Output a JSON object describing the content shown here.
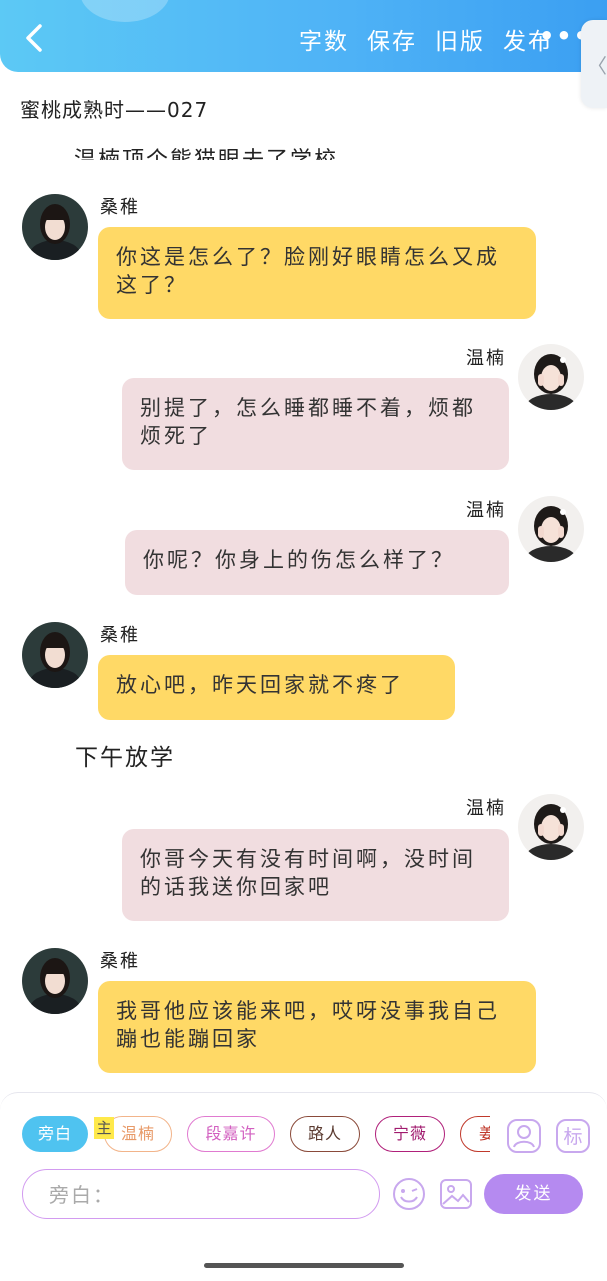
{
  "header": {
    "actions": [
      "字数",
      "保存",
      "旧版",
      "发布"
    ],
    "more_label": "•••",
    "side_tab_glyph": "〈"
  },
  "doc": {
    "title": "蜜桃成熟时——027",
    "clipped_line": "温楠顶个熊猫眼去了学校"
  },
  "messages": [
    {
      "speaker": "桑稚",
      "side": "left",
      "text": "你这是怎么了？脸刚好眼睛怎么又成这了？"
    },
    {
      "speaker": "温楠",
      "side": "right",
      "text": "别提了，怎么睡都睡不着，烦都烦死了"
    },
    {
      "speaker": "温楠",
      "side": "right",
      "text": "你呢？你身上的伤怎么样了？"
    },
    {
      "speaker": "桑稚",
      "side": "left",
      "text": "放心吧，昨天回家就不疼了"
    },
    {
      "speaker": "温楠",
      "side": "right",
      "text": "你哥今天有没有时间啊，没时间的话我送你回家吧"
    },
    {
      "speaker": "桑稚",
      "side": "left",
      "text": "我哥他应该能来吧，哎呀没事我自己蹦也能蹦回家"
    }
  ],
  "narration": "下午放学",
  "composer": {
    "chips": [
      {
        "label": "旁白",
        "active": true,
        "color": "#4fc3f0"
      },
      {
        "label": "温楠",
        "active": false,
        "color": "#f2b48a"
      },
      {
        "label": "段嘉许",
        "active": false,
        "color": "#e07ad0"
      },
      {
        "label": "路人",
        "active": false,
        "color": "#8a4a3a"
      },
      {
        "label": "宁薇",
        "active": false,
        "color": "#b0207a"
      },
      {
        "label": "姜",
        "active": false,
        "color": "#c0392b"
      }
    ],
    "main_tag": "主",
    "placeholder": "旁白：",
    "send_label": "发送",
    "role_icon_glyph": "标"
  },
  "colors": {
    "header_gradient_start": "#5cc9f5",
    "header_gradient_end": "#3b9ff2",
    "bubble_left": "#ffd966",
    "bubble_right": "#f1dde0",
    "send_button": "#b58af0",
    "input_border": "#d29bf0"
  }
}
